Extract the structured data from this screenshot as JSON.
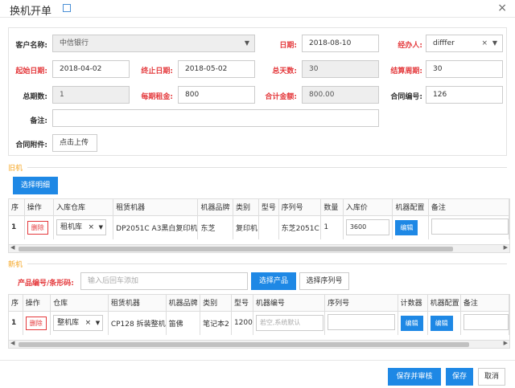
{
  "window": {
    "title": "换机开单",
    "close": "×"
  },
  "form": {
    "customer_label": "客户名称:",
    "customer_value": "中信银行",
    "date_label": "日期:",
    "date_value": "2018-08-10",
    "handler_label": "经办人:",
    "handler_value": "difffer",
    "start_label": "起始日期:",
    "start_value": "2018-04-02",
    "end_label": "终止日期:",
    "end_value": "2018-05-02",
    "days_label": "总天数:",
    "days_value": "30",
    "cycle_label": "结算周期:",
    "cycle_value": "30",
    "periods_label": "总期数:",
    "periods_value": "1",
    "rent_label": "每期租金:",
    "rent_value": "800",
    "total_label": "合计金额:",
    "total_value": "800.00",
    "contract_no_label": "合同编号:",
    "contract_no_value": "126",
    "remark_label": "备注:",
    "remark_value": "",
    "attach_label": "合同附件:",
    "upload_label": "点击上传"
  },
  "old_section": {
    "title": "旧机",
    "select_detail": "选择明细",
    "columns": [
      "序",
      "操作",
      "入库仓库",
      "租赁机器",
      "机器品牌",
      "类别",
      "型号",
      "序列号",
      "数量",
      "入库价",
      "机器配置",
      "备注"
    ],
    "row": {
      "index": "1",
      "delete": "删除",
      "warehouse": "租机库",
      "machine": "DP2051C A3黑白复印机",
      "brand": "东芝",
      "category": "复印机",
      "model": "",
      "serial": "东芝2051C",
      "qty": "1",
      "price": "3600",
      "config": "编辑",
      "remark": ""
    }
  },
  "new_section": {
    "title": "新机",
    "barcode_label": "产品编号/条形码:",
    "barcode_placeholder": "输入后回车添加",
    "select_product": "选择产品",
    "select_serial": "选择序列号",
    "columns": [
      "序",
      "操作",
      "仓库",
      "租赁机器",
      "机器品牌",
      "类别",
      "型号",
      "机器编号",
      "序列号",
      "计数器",
      "机器配置",
      "备注"
    ],
    "row": {
      "index": "1",
      "delete": "删除",
      "warehouse": "整机库",
      "machine": "CP128 拆装整机",
      "brand": "笛佛",
      "category": "笔记本2",
      "model": "1200",
      "machine_no_placeholder": "若空,系统默认",
      "serial": "",
      "counter": "编辑",
      "config": "编辑",
      "remark": ""
    }
  },
  "footer": {
    "save_audit": "保存并审核",
    "save": "保存",
    "cancel": "取消"
  },
  "colors": {
    "accent": "#1e88e5",
    "danger": "#e4393c",
    "section": "#f5a623"
  }
}
